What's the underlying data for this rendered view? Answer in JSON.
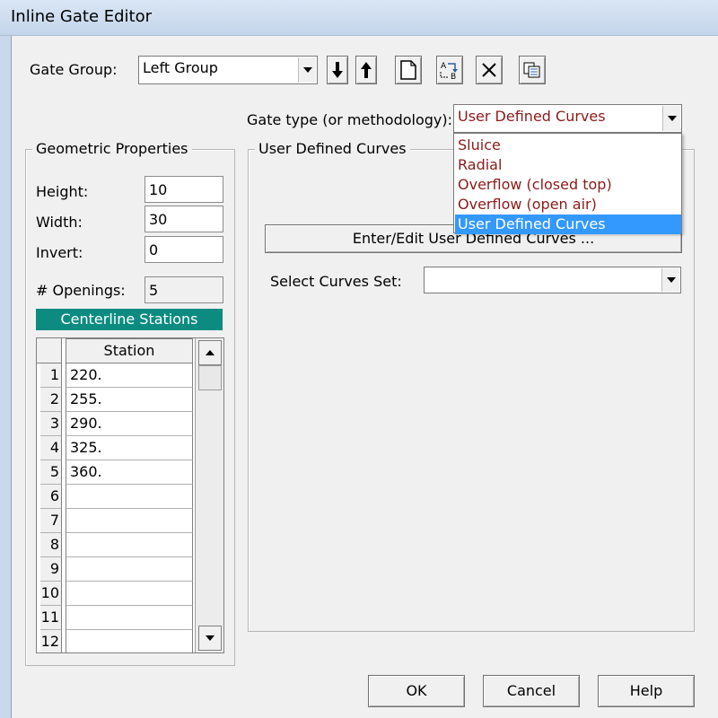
{
  "window": {
    "title": "Inline Gate Editor"
  },
  "gate_group": {
    "label": "Gate Group:",
    "value": "Left Group"
  },
  "toolbar": {
    "icons": [
      "move-down-icon",
      "move-up-icon",
      "new-icon",
      "rename-icon",
      "delete-icon",
      "copy-icon"
    ]
  },
  "gate_type": {
    "label": "Gate type (or methodology):",
    "value": "User Defined Curves",
    "options": [
      "Sluice",
      "Radial",
      "Overflow (closed top)",
      "Overflow (open air)",
      "User Defined Curves"
    ],
    "selected_index": 4,
    "option_color": "#8b1a1a"
  },
  "geometric": {
    "title": "Geometric Properties",
    "height_label": "Height:",
    "height": "10",
    "width_label": "Width:",
    "width": "30",
    "invert_label": "Invert:",
    "invert": "0",
    "openings_label": "# Openings:",
    "openings": "5"
  },
  "centerline": {
    "title": "Centerline Stations",
    "color": "#0c8c80",
    "column_header": "Station",
    "rows": [
      {
        "n": "1",
        "station": "220."
      },
      {
        "n": "2",
        "station": "255."
      },
      {
        "n": "3",
        "station": "290."
      },
      {
        "n": "4",
        "station": "325."
      },
      {
        "n": "5",
        "station": "360."
      },
      {
        "n": "6",
        "station": ""
      },
      {
        "n": "7",
        "station": ""
      },
      {
        "n": "8",
        "station": ""
      },
      {
        "n": "9",
        "station": ""
      },
      {
        "n": "10",
        "station": ""
      },
      {
        "n": "11",
        "station": ""
      },
      {
        "n": "12",
        "station": ""
      }
    ]
  },
  "udc": {
    "title": "User Defined Curves",
    "edit_button": "Enter/Edit User Defined Curves ...",
    "curves_set_label": "Select Curves Set:",
    "curves_set_value": ""
  },
  "buttons": {
    "ok": "OK",
    "cancel": "Cancel",
    "help": "Help"
  }
}
